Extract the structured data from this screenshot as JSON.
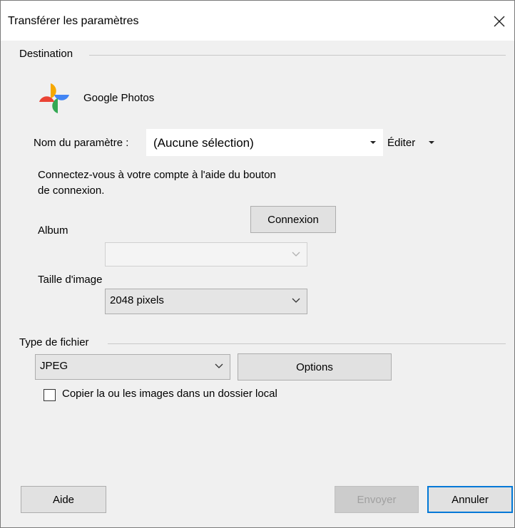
{
  "window": {
    "title": "Transférer les paramètres",
    "close_icon": "close-icon"
  },
  "destination": {
    "group_label": "Destination",
    "service_icon": "google-photos-pinwheel-icon",
    "service_name": "Google Photos",
    "setting_name_label": "Nom du paramètre :",
    "setting_name_value": "(Aucune sélection)",
    "edit_label": "Éditer",
    "connect_instructions_line1": "Connectez-vous à votre compte à l'aide du bouton",
    "connect_instructions_line2": "de connexion.",
    "connect_button": "Connexion",
    "album_label": "Album",
    "album_value": "",
    "image_size_label": "Taille d'image",
    "image_size_value": "2048 pixels"
  },
  "file_type": {
    "group_label": "Type de fichier",
    "selected": "JPEG",
    "options_button": "Options",
    "copy_local_label": "Copier la ou les images dans un dossier local",
    "copy_local_checked": false
  },
  "footer": {
    "help_button": "Aide",
    "send_button": "Envoyer",
    "cancel_button": "Annuler"
  }
}
